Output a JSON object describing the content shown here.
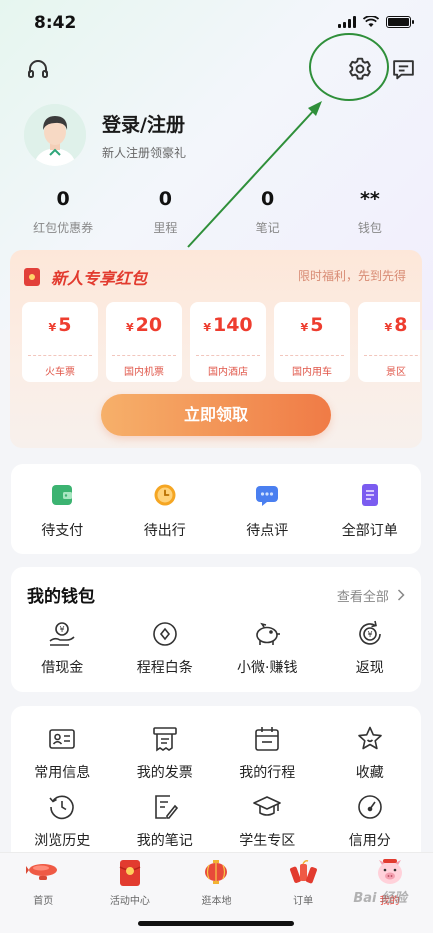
{
  "status": {
    "time": "8:42"
  },
  "profile": {
    "title": "登录/注册",
    "subtitle": "新人注册领豪礼"
  },
  "stats": [
    {
      "value": "0",
      "label": "红包优惠券"
    },
    {
      "value": "0",
      "label": "里程"
    },
    {
      "value": "0",
      "label": "笔记"
    },
    {
      "value": "**",
      "label": "钱包"
    }
  ],
  "redpacket": {
    "title": "新人专享红包",
    "tag": "限时福利，先到先得",
    "currency": "¥",
    "coupons": [
      {
        "amount": "5",
        "label": "火车票"
      },
      {
        "amount": "20",
        "label": "国内机票"
      },
      {
        "amount": "140",
        "label": "国内酒店"
      },
      {
        "amount": "5",
        "label": "国内用车"
      },
      {
        "amount": "8",
        "label": "景区"
      }
    ],
    "button": "立即领取"
  },
  "orders": [
    {
      "label": "待支付",
      "icon": "wallet-icon",
      "color": "#3cb371"
    },
    {
      "label": "待出行",
      "icon": "clock-icon",
      "color": "#f5a623"
    },
    {
      "label": "待点评",
      "icon": "comment-icon",
      "color": "#4a7ff0"
    },
    {
      "label": "全部订单",
      "icon": "order-list-icon",
      "color": "#7b5cf0"
    }
  ],
  "wallet": {
    "title": "我的钱包",
    "more": "查看全部",
    "items": [
      {
        "label": "借现金",
        "icon": "cash-hand-icon"
      },
      {
        "label": "程程白条",
        "icon": "credit-coin-icon"
      },
      {
        "label": "小微·赚钱",
        "icon": "piggy-bank-icon"
      },
      {
        "label": "返现",
        "icon": "cashback-icon"
      }
    ]
  },
  "services": [
    {
      "label": "常用信息",
      "icon": "id-card-icon"
    },
    {
      "label": "我的发票",
      "icon": "invoice-icon"
    },
    {
      "label": "我的行程",
      "icon": "calendar-icon"
    },
    {
      "label": "收藏",
      "icon": "star-icon"
    },
    {
      "label": "浏览历史",
      "icon": "history-icon"
    },
    {
      "label": "我的笔记",
      "icon": "note-edit-icon"
    },
    {
      "label": "学生专区",
      "icon": "graduation-cap-icon"
    },
    {
      "label": "信用分",
      "icon": "gauge-icon"
    }
  ],
  "tabbar": [
    {
      "label": "首页",
      "icon": "airship-icon"
    },
    {
      "label": "活动中心",
      "icon": "red-envelope-icon"
    },
    {
      "label": "逛本地",
      "icon": "lantern-icon"
    },
    {
      "label": "订单",
      "icon": "firecracker-icon"
    },
    {
      "label": "我的",
      "icon": "pig-mascot-icon",
      "active": true
    }
  ],
  "watermark": "Bai 经验",
  "colors": {
    "accent_red": "#e23b2f",
    "annotation_green": "#2f8f3a"
  }
}
